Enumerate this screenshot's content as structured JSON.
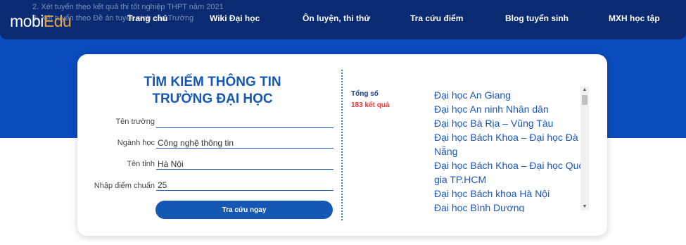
{
  "overlay_lines": [
    "2. Xét tuyển theo kết quả thi tốt nghiệp THPT năm 2021",
    "3. Xét tuyển theo Đề án tuyển sinh của Trường"
  ],
  "logo": {
    "main": "mobi",
    "accent": "Edu"
  },
  "nav": [
    "Trang chủ",
    "Wiki Đại học",
    "Ôn luyện, thi thử",
    "Tra cứu điểm",
    "Blog tuyển sinh",
    "MXH học tập"
  ],
  "search": {
    "title_line1": "TÌM KIẾM THÔNG TIN",
    "title_line2": "TRƯỜNG ĐẠI HỌC",
    "fields": {
      "school": {
        "label": "Tên trường",
        "value": ""
      },
      "major": {
        "label": "Ngành học",
        "value": "Công nghệ thông tin"
      },
      "province": {
        "label": "Tên tỉnh",
        "value": "Hà Nội"
      },
      "score": {
        "label": "Nhập điểm chuẩn",
        "value": "25"
      }
    },
    "button": "Tra cứu ngay"
  },
  "results": {
    "total_label": "Tổng số",
    "total_count": "183 kết quả",
    "items": [
      "Đại học An Giang",
      "Đại học An ninh Nhân dân",
      "Đại học Bà Rịa – Vũng Tàu",
      "Đại học Bách Khoa – Đại học Đà Nẵng",
      "Đại học Bách Khoa – Đại học Quốc gia TP.HCM",
      "Đại học Bách khoa Hà Nội",
      "Đại học Bình Dương"
    ]
  },
  "colors": {
    "navbar": "#0a2a72",
    "hero": "#0b4bbd",
    "primary": "#1558b3",
    "logo_accent": "#e9a23a",
    "count": "#e53935"
  }
}
